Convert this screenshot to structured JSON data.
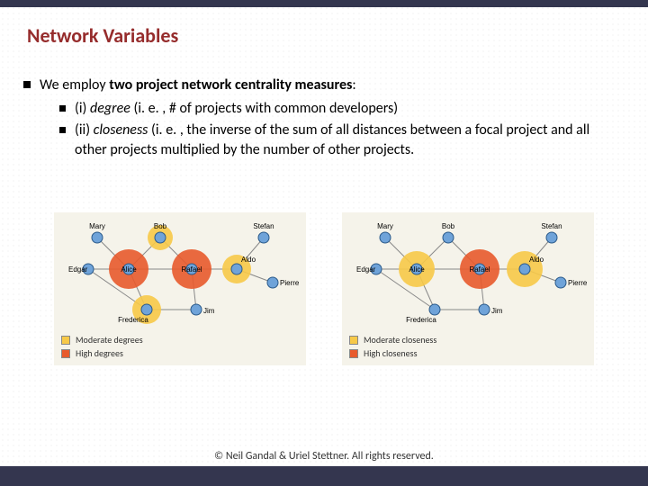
{
  "title": "Network Variables",
  "bullets": {
    "main": {
      "pre": "We employ ",
      "bold": "two project network centrality measures",
      "post": ":"
    },
    "sub1": {
      "pre": "(i) ",
      "italic": "degree",
      "post": " (i. e. , # of projects with common developers)"
    },
    "sub2": {
      "pre": "(ii) ",
      "italic": "closeness",
      "post": " (i. e. , the inverse of the sum of all distances between a focal project and all other projects multiplied by the number of other projects."
    }
  },
  "diagram_labels": {
    "names": [
      "Mary",
      "Bob",
      "Stefan",
      "Edgar",
      "Alice",
      "Rafael",
      "Aldo",
      "Pierre",
      "Frederica",
      "Jim"
    ],
    "legend_left": {
      "moderate": "Moderate degrees",
      "high": "High degrees"
    },
    "legend_right": {
      "moderate": "Moderate closeness",
      "high": "High closeness"
    }
  },
  "footer": "© Neil Gandal & Uriel Stettner. All rights reserved."
}
